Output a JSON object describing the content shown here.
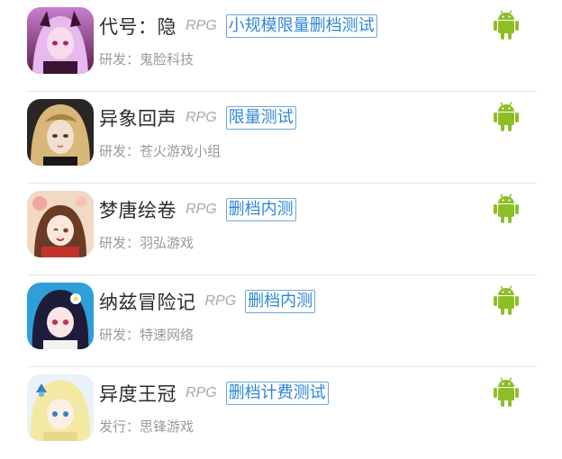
{
  "games": [
    {
      "name": "代号：隐",
      "genre": "RPG",
      "test_type": "小规模限量删档测试",
      "meta": "研发：鬼脸科技",
      "platform_icon": "android-icon",
      "icon_colors": [
        "#5a1f4a",
        "#c77fd0"
      ]
    },
    {
      "name": "异象回声",
      "genre": "RPG",
      "test_type": "限量测试",
      "meta": "研发：苍火游戏小组",
      "platform_icon": "android-icon",
      "icon_colors": [
        "#2a2626",
        "#d9b77a"
      ]
    },
    {
      "name": "梦唐绘卷",
      "genre": "RPG",
      "test_type": "删档内测",
      "meta": "研发：羽弘游戏",
      "platform_icon": "android-icon",
      "icon_colors": [
        "#f2d9c4",
        "#c0342b"
      ]
    },
    {
      "name": "纳兹冒险记",
      "genre": "RPG",
      "test_type": "删档内测",
      "meta": "研发：特速网络",
      "platform_icon": "android-icon",
      "icon_colors": [
        "#2e9fd8",
        "#1e1c3a"
      ]
    },
    {
      "name": "异度王冠",
      "genre": "RPG",
      "test_type": "删档计费测试",
      "meta": "发行：思锋游戏",
      "platform_icon": "android-icon",
      "icon_colors": [
        "#f3e9a3",
        "#3c7fbf"
      ]
    }
  ],
  "colors": {
    "android_green": "#8cbf26",
    "badge_blue": "#2f86d6",
    "title": "#2b2b2b",
    "secondary": "#9a9a9a"
  }
}
